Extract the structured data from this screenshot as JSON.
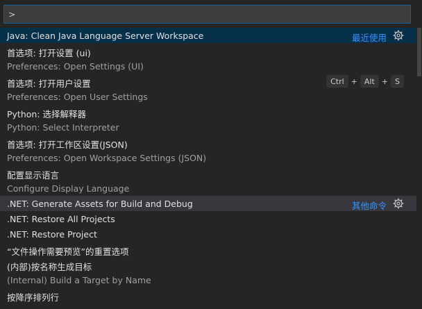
{
  "input": {
    "value": ">"
  },
  "colors": {
    "accent": "#3794ff",
    "active_bg": "#062f4a",
    "hover_bg": "#37373d",
    "focus_border": "#0e639c"
  },
  "items": [
    {
      "label": "Java: Clean Java Language Server Workspace",
      "group": "最近使用",
      "gear": true,
      "state": "active"
    },
    {
      "label": "首选项: 打开设置 (ui)",
      "detail": "Preferences: Open Settings (UI)"
    },
    {
      "label": "首选项: 打开用户设置",
      "detail": "Preferences: Open User Settings",
      "keys": [
        "Ctrl",
        "Alt",
        "S"
      ]
    },
    {
      "label": "Python: 选择解释器",
      "detail": "Python: Select Interpreter"
    },
    {
      "label": "首选项: 打开工作区设置(JSON)",
      "detail": "Preferences: Open Workspace Settings (JSON)"
    },
    {
      "label": "配置显示语言",
      "detail": "Configure Display Language"
    },
    {
      "label": ".NET: Generate Assets for Build and Debug",
      "group": "其他命令",
      "gear": true,
      "state": "hover"
    },
    {
      "label": ".NET: Restore All Projects"
    },
    {
      "label": ".NET: Restore Project"
    },
    {
      "label": "“文件操作需要预览”的重置选项"
    },
    {
      "label": "(内部)按名称生成目标",
      "detail": "(Internal) Build a Target by Name"
    },
    {
      "label": "按降序排列行"
    }
  ]
}
